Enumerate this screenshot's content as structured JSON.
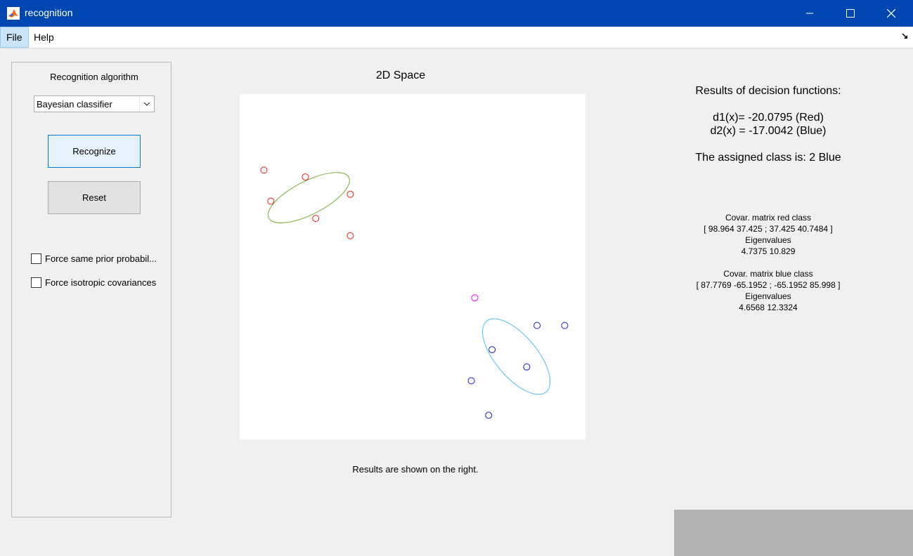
{
  "window": {
    "title": "recognition"
  },
  "menu": {
    "file": "File",
    "help": "Help"
  },
  "panel": {
    "algorithm_label": "Recognition algorithm",
    "algorithm_selected": "Bayesian classifier",
    "recognize": "Recognize",
    "reset": "Reset",
    "checkbox1": "Force same prior probabil...",
    "checkbox2": "Force isotropic covariances",
    "checkbox1_checked": false,
    "checkbox2_checked": false
  },
  "plot": {
    "title": "2D Space",
    "status": "Results are shown on the right."
  },
  "chart_data": {
    "type": "scatter",
    "title": "2D Space",
    "xlim": [
      0,
      100
    ],
    "ylim": [
      0,
      100
    ],
    "grid": false,
    "series": [
      {
        "color": "#e8211b",
        "points": [
          [
            7,
            78
          ],
          [
            19,
            76
          ],
          [
            32,
            71
          ],
          [
            9,
            69
          ],
          [
            22,
            64
          ],
          [
            32,
            59
          ]
        ]
      },
      {
        "color": "#1a1ad8",
        "points": [
          [
            86,
            33
          ],
          [
            94,
            33
          ],
          [
            73,
            26
          ],
          [
            83,
            21
          ],
          [
            67,
            17
          ],
          [
            72,
            7
          ]
        ]
      },
      {
        "color": "#ff00ff",
        "points": [
          [
            68,
            41
          ]
        ]
      }
    ],
    "ellipses": [
      {
        "color": "#77ac30",
        "center": [
          20,
          70
        ],
        "rx": 13,
        "ry": 4.8,
        "angle_deg": -27
      },
      {
        "color": "#4dbeee",
        "center": [
          80,
          24
        ],
        "rx": 13.4,
        "ry": 6,
        "angle_deg": 50
      }
    ]
  },
  "results": {
    "header": "Results of decision functions:",
    "d1": "d1(x)= -20.0795  (Red)",
    "d2": "d2(x) = -17.0042  (Blue)",
    "assigned": "The assigned class is: 2 Blue",
    "cov_red_title": "Covar. matrix red class",
    "cov_red": "[ 98.964 37.425 ; 37.425 40.7484 ]",
    "eig_red_title": "Eigenvalues",
    "eig_red": "4.7375     10.829",
    "cov_blue_title": "Covar. matrix blue class",
    "cov_blue": "[ 87.7769 -65.1952 ; -65.1952 85.998 ]",
    "eig_blue_title": "Eigenvalues",
    "eig_blue": "4.6568     12.3324"
  }
}
